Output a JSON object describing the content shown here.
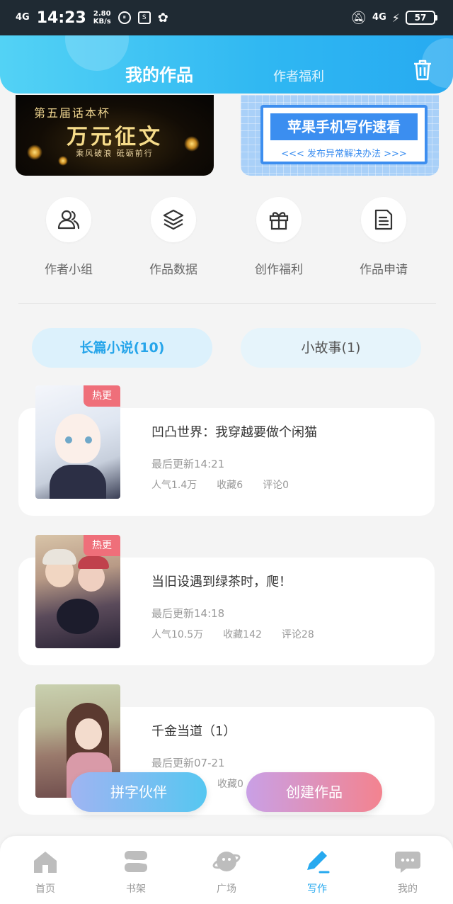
{
  "status_bar": {
    "network": "4G",
    "time": "14:23",
    "speed_value": "2.80",
    "speed_unit": "KB/s",
    "network_right": "4G",
    "battery": "57"
  },
  "header": {
    "tab_active": "我的作品",
    "tab_inactive": "作者福利"
  },
  "banners": {
    "left": {
      "small_text": "第五届话本杯",
      "big_text": "万元征文",
      "sub_text": "乘风破浪 砥砺前行"
    },
    "right": {
      "title": "苹果手机写作速看",
      "subtitle": "<<< 发布异常解决办法 >>>"
    }
  },
  "shortcuts": [
    {
      "label": "作者小组",
      "icon": "author-group-icon"
    },
    {
      "label": "作品数据",
      "icon": "layers-icon"
    },
    {
      "label": "创作福利",
      "icon": "gift-icon"
    },
    {
      "label": "作品申请",
      "icon": "document-icon"
    }
  ],
  "categories": {
    "active": "长篇小说(10)",
    "inactive": "小故事(1)"
  },
  "works": [
    {
      "title": "凹凸世界：我穿越要做个闲猫",
      "badge": "热更",
      "update": "最后更新14:21",
      "popularity": "人气1.4万",
      "favorites": "收藏6",
      "comments": "评论0"
    },
    {
      "title": "当旧设遇到绿茶时，爬！",
      "badge": "热更",
      "update": "最后更新14:18",
      "popularity": "人气10.5万",
      "favorites": "收藏142",
      "comments": "评论28"
    },
    {
      "title": "千金当道（1）",
      "update": "最后更新07-21",
      "favorites": "收藏0"
    }
  ],
  "buttons": {
    "partner": "拼字伙伴",
    "create": "创建作品"
  },
  "bottom_nav": [
    {
      "label": "首页",
      "icon": "home-icon"
    },
    {
      "label": "书架",
      "icon": "bookshelf-icon"
    },
    {
      "label": "广场",
      "icon": "planet-icon"
    },
    {
      "label": "写作",
      "icon": "pen-icon",
      "active": true
    },
    {
      "label": "我的",
      "icon": "chat-icon"
    }
  ],
  "colors": {
    "accent": "#27a9ef",
    "hot_badge": "#ef6f7a",
    "header_start": "#53d2f5",
    "header_end": "#27aaf1"
  }
}
